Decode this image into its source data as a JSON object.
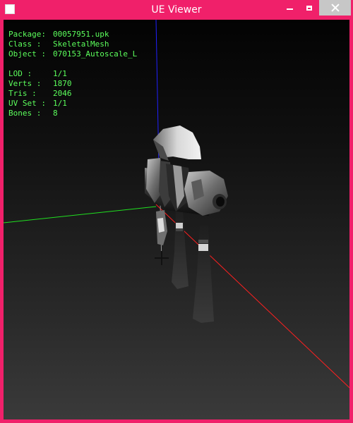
{
  "window": {
    "title": "UE Viewer",
    "accent": "#f0206a"
  },
  "controls": {
    "minimize_icon": "minimize-icon",
    "maximize_icon": "maximize-icon",
    "close_icon": "close-icon"
  },
  "info": {
    "package": {
      "label": "Package:",
      "value": "00057951.upk"
    },
    "class": {
      "label": "Class  :",
      "value": "SkeletalMesh"
    },
    "object": {
      "label": "Object :",
      "value": "070153_Autoscale_L"
    },
    "lod": {
      "label": "LOD    :",
      "value": "1/1"
    },
    "verts": {
      "label": "Verts  :",
      "value": "1870"
    },
    "tris": {
      "label": "Tris   :",
      "value": "2046"
    },
    "uvset": {
      "label": "UV Set :",
      "value": "1/1"
    },
    "bones": {
      "label": "Bones  :",
      "value": "8"
    }
  },
  "axes": {
    "x_color": "#ff2020",
    "y_color": "#20e020",
    "z_color": "#2020ff"
  },
  "info_color": "#5cff5c"
}
